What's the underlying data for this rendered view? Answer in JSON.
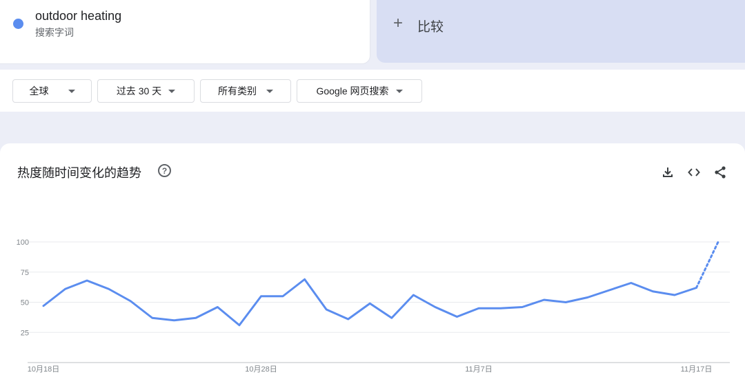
{
  "term": {
    "name": "outdoor heating",
    "type": "搜索字词",
    "color": "#5b8def"
  },
  "compare": {
    "plus": "+",
    "label": "比较"
  },
  "filters": [
    {
      "label": "全球"
    },
    {
      "label": "过去 30 天"
    },
    {
      "label": "所有类别"
    },
    {
      "label": "Google 网页搜索"
    }
  ],
  "chart_header": {
    "title": "热度随时间变化的趋势",
    "help": "?"
  },
  "toolbar_icons": [
    "download-icon",
    "embed-icon",
    "share-icon"
  ],
  "chart_data": {
    "type": "line",
    "title": "热度随时间变化的趋势",
    "xlabel": "",
    "ylabel": "",
    "x_tick_labels": [
      "10月18日",
      "10月28日",
      "11月7日",
      "11月17日"
    ],
    "y_ticks": [
      25,
      50,
      75,
      100
    ],
    "ylim": [
      0,
      100
    ],
    "grid": true,
    "series": [
      {
        "values": [
          47,
          61,
          68,
          61,
          51,
          37,
          35,
          37,
          46,
          31,
          55,
          55,
          69,
          44,
          36,
          49,
          37,
          56,
          46,
          38,
          45,
          45,
          46,
          52,
          50,
          54,
          60,
          66,
          59,
          56,
          62
        ],
        "partial_values": [
          62,
          100
        ],
        "color": "#5b8def"
      }
    ]
  }
}
